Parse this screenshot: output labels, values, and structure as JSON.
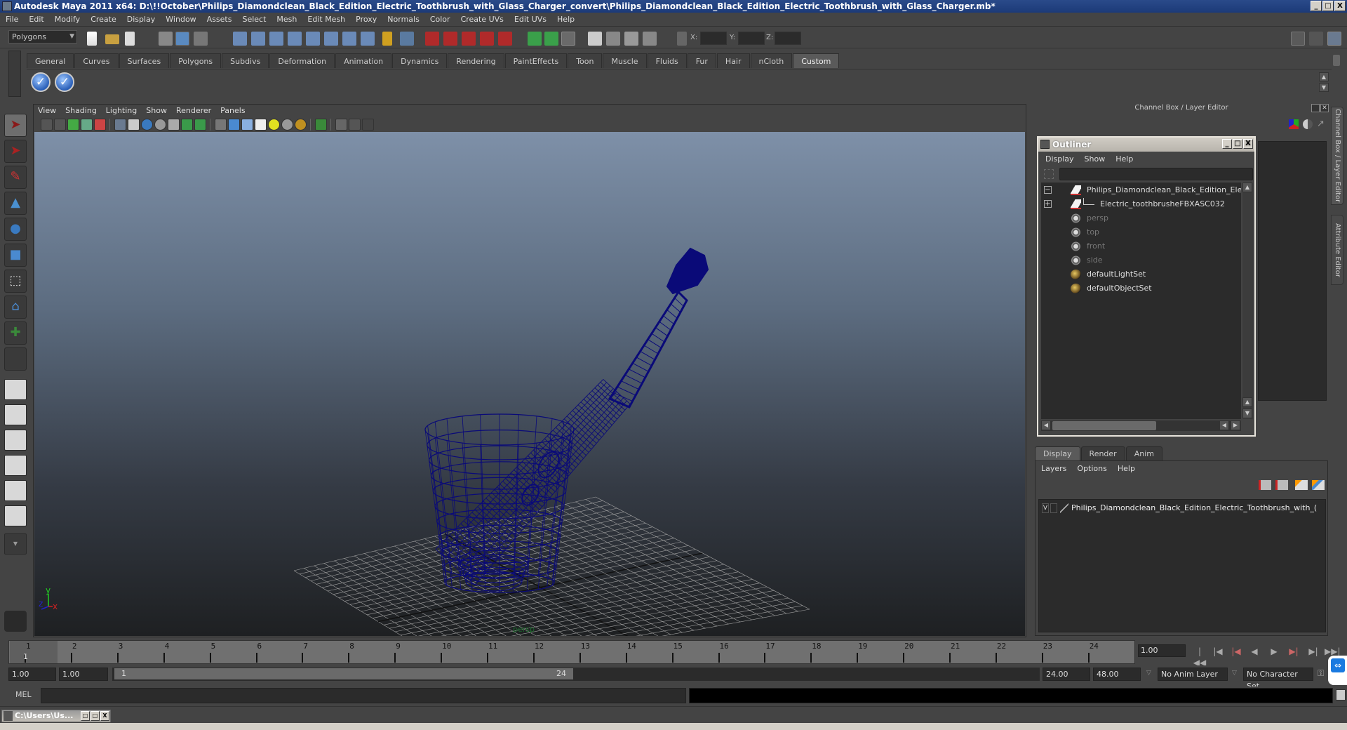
{
  "window": {
    "title": "Autodesk Maya 2011 x64: D:\\!!October\\Philips_Diamondclean_Black_Edition_Electric_Toothbrush_with_Glass_Charger_convert\\Philips_Diamondclean_Black_Edition_Electric_Toothbrush_with_Glass_Charger.mb*",
    "minimize": "_",
    "maximize": "□",
    "close": "X"
  },
  "menubar": [
    "File",
    "Edit",
    "Modify",
    "Create",
    "Display",
    "Window",
    "Assets",
    "Select",
    "Mesh",
    "Edit Mesh",
    "Proxy",
    "Normals",
    "Color",
    "Create UVs",
    "Edit UVs",
    "Help"
  ],
  "statusline": {
    "mode": "Polygons",
    "x_label": "X:",
    "y_label": "Y:",
    "z_label": "Z:",
    "x_value": "",
    "y_value": "",
    "z_value": ""
  },
  "shelf": {
    "tabs": [
      "General",
      "Curves",
      "Surfaces",
      "Polygons",
      "Subdivs",
      "Deformation",
      "Animation",
      "Dynamics",
      "Rendering",
      "PaintEffects",
      "Toon",
      "Muscle",
      "Fluids",
      "Fur",
      "Hair",
      "nCloth",
      "Custom"
    ],
    "active_tab": "Custom",
    "buttons": [
      "checkmark-shelf-1",
      "checkmark-shelf-2"
    ]
  },
  "toolbox": {
    "tools": [
      "select-tool",
      "lasso-tool",
      "paint-select-tool",
      "move-tool",
      "rotate-tool",
      "scale-tool",
      "universal-manipulator",
      "soft-modification-tool",
      "show-manipulator-tool",
      "last-tool-used"
    ]
  },
  "viewport": {
    "menu": [
      "View",
      "Shading",
      "Lighting",
      "Show",
      "Renderer",
      "Panels"
    ],
    "camera_label": "persp",
    "axis": {
      "x": "x",
      "y": "y",
      "z": "z"
    },
    "wire_color": "#0a0a78",
    "grid_color": "#a0a0a0"
  },
  "channel_box": {
    "header": "Channel Box / Layer Editor"
  },
  "side_tabs": [
    "Channel Box / Layer Editor",
    "Attribute Editor"
  ],
  "outliner": {
    "title": "Outliner",
    "menu": [
      "Display",
      "Show",
      "Help"
    ],
    "filter_value": "",
    "items": [
      {
        "label": "Philips_Diamondclean_Black_Edition_Electric_",
        "type": "transform",
        "expand": "−",
        "dim": false
      },
      {
        "label": "Electric_toothbrusheFBXASC032",
        "type": "transform",
        "expand": "+",
        "dim": false
      },
      {
        "label": "persp",
        "type": "camera",
        "expand": "",
        "dim": true
      },
      {
        "label": "top",
        "type": "camera",
        "expand": "",
        "dim": true
      },
      {
        "label": "front",
        "type": "camera",
        "expand": "",
        "dim": true
      },
      {
        "label": "side",
        "type": "camera",
        "expand": "",
        "dim": true
      },
      {
        "label": "defaultLightSet",
        "type": "set",
        "expand": "",
        "dim": false
      },
      {
        "label": "defaultObjectSet",
        "type": "set",
        "expand": "",
        "dim": false
      }
    ]
  },
  "layer_editor": {
    "tabs": [
      "Display",
      "Render",
      "Anim"
    ],
    "active_tab": "Display",
    "menu": [
      "Layers",
      "Options",
      "Help"
    ],
    "layers": [
      {
        "visible": "V",
        "template": "",
        "name": "Philips_Diamondclean_Black_Edition_Electric_Toothbrush_with_("
      }
    ]
  },
  "timeline": {
    "start": 1,
    "end": 24,
    "ticks": [
      "1",
      "2",
      "3",
      "4",
      "5",
      "6",
      "7",
      "8",
      "9",
      "10",
      "11",
      "12",
      "13",
      "14",
      "15",
      "16",
      "17",
      "18",
      "19",
      "20",
      "21",
      "22",
      "23",
      "24"
    ],
    "current_frame_marker": "1",
    "current_frame": "1.00"
  },
  "playback": {
    "buttons": [
      "go-to-start",
      "step-back-frame",
      "step-back-key",
      "play-backward",
      "play-forward",
      "step-forward-key",
      "step-forward-frame",
      "go-to-end"
    ],
    "glyphs": [
      "|◀◀",
      "|◀",
      "|◀",
      "◀",
      "▶",
      "▶|",
      "▶|",
      "▶▶|"
    ]
  },
  "range": {
    "start_time": "1.00",
    "playback_start": "1.00",
    "slider_start": "1",
    "slider_end": "24",
    "playback_end": "24.00",
    "end_time": "48.00",
    "anim_layer": "No Anim Layer",
    "character_set": "No Character Set"
  },
  "command_line": {
    "label": "MEL",
    "input": "",
    "output": ""
  },
  "minimized_window": {
    "title": "C:\\Users\\Us..."
  }
}
